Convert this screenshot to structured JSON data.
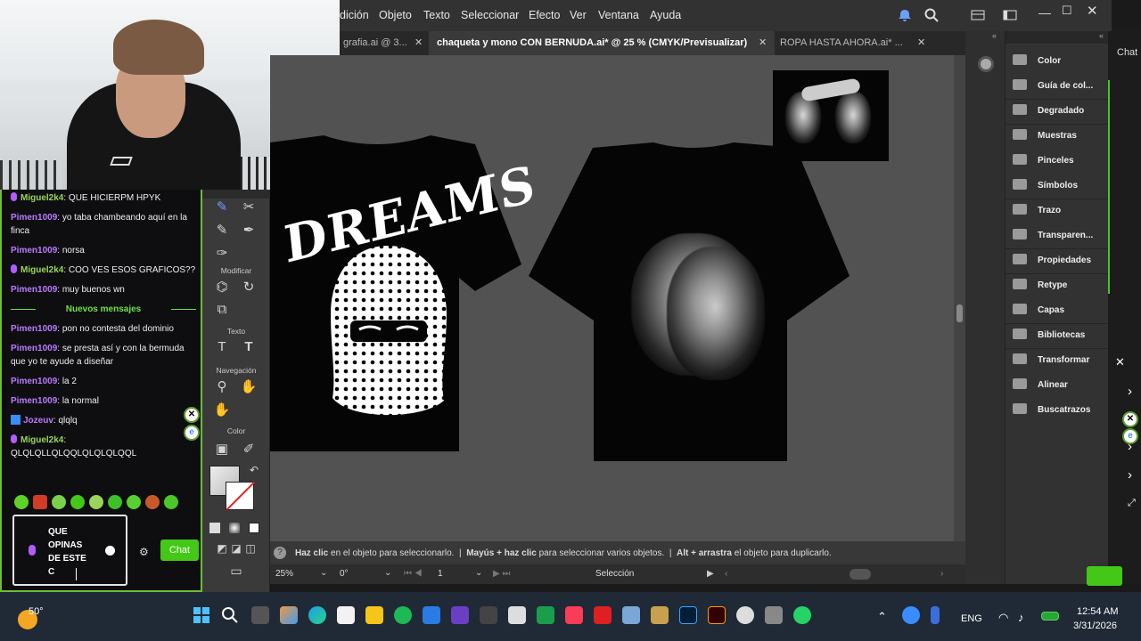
{
  "illustrator": {
    "menu": [
      "dición",
      "Objeto",
      "Texto",
      "Seleccionar",
      "Efecto",
      "Ver",
      "Ventana",
      "Ayuda"
    ],
    "tabs": [
      {
        "label": "grafia.ai @ 3...",
        "active": false
      },
      {
        "label": "chaqueta y mono CON BERNUDA.ai* @ 25 % (CMYK/Previsualizar)",
        "active": true
      },
      {
        "label": "ROPA HASTA AHORA.ai* ...",
        "active": false
      }
    ],
    "tools_labels": {
      "modify": "Modificar",
      "text": "Texto",
      "navigation": "Navegación",
      "color": "Color"
    },
    "statusbar": {
      "hint1_bold": "Haz clic",
      "hint1": "en el objeto para seleccionarlo.",
      "hint2_bold": "Mayús + haz clic",
      "hint2": "para seleccionar varios objetos.",
      "hint3_bold": "Alt + arrastra",
      "hint3": "el objeto para duplicarlo."
    },
    "bottombar": {
      "zoom": "25%",
      "rotation": "0°",
      "artboard": "1",
      "tool": "Selección"
    },
    "panels": [
      "Color",
      "Guía de col...",
      "Degradado",
      "Muestras",
      "Pinceles",
      "Símbolos",
      "Trazo",
      "Transparen...",
      "Propiedades",
      "Retype",
      "Capas",
      "Bibliotecas",
      "Transformar",
      "Alinear",
      "Buscatrazos"
    ],
    "artwork": {
      "dreams_text": "DREAMS"
    }
  },
  "chat": {
    "messages": [
      {
        "user": "Miguel2k4",
        "text": "QUE HICIERPM HPYK",
        "badge": "mic",
        "color": "green"
      },
      {
        "user": "Pimen1009",
        "text": "yo taba chambeando aquí en la finca",
        "color": "purple"
      },
      {
        "user": "Pimen1009",
        "text": "norsa",
        "color": "purple"
      },
      {
        "user": "Miguel2k4",
        "text": "COO VES ESOS GRAFICOS??",
        "badge": "mic",
        "color": "green"
      },
      {
        "user": "Pimen1009",
        "text": "muy buenos wn",
        "color": "purple"
      }
    ],
    "new_messages_label": "Nuevos mensajes",
    "messages_after": [
      {
        "user": "Pimen1009",
        "text": "pon no contesta del dominio",
        "color": "purple"
      },
      {
        "user": "Pimen1009",
        "text": "se presta así y con la bermuda que yo te ayude a diseñar",
        "color": "purple"
      },
      {
        "user": "Pimen1009",
        "text": "la 2",
        "color": "purple"
      },
      {
        "user": "Pimen1009",
        "text": "la normal",
        "color": "purple"
      },
      {
        "user": "Jozeuv",
        "text": "qlqlq",
        "badge": "twitch",
        "color": "purple"
      },
      {
        "user": "Miguel2k4",
        "text": "QLQLQLLQLQQLQLQLQLQQL",
        "badge": "mic",
        "color": "green"
      }
    ],
    "input_text": "QUE\nOPINAS\nDE ESTE\nC",
    "chat_button": "Chat",
    "side_label": "Chat"
  },
  "taskbar": {
    "weather": "50°",
    "language": "ENG",
    "time": "12:54 AM",
    "date": "3/31/2026"
  }
}
